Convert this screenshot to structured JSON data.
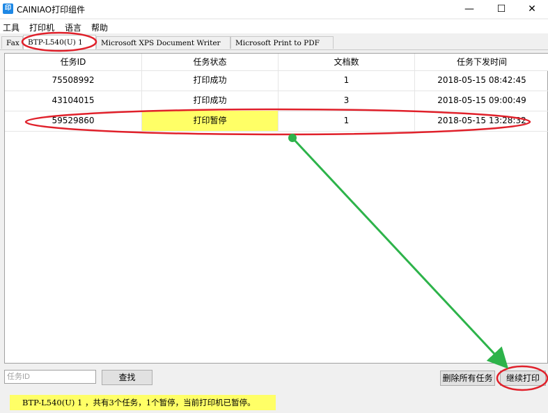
{
  "window": {
    "title": "CAINIAO打印组件",
    "icon_text": "印",
    "minimize_glyph": "—",
    "maximize_glyph": "☐",
    "close_glyph": "✕"
  },
  "menu": [
    "工具",
    "打印机",
    "语言",
    "帮助"
  ],
  "tabs": [
    {
      "label": "Fax",
      "active": false
    },
    {
      "label": "BTP-L540(U) 1",
      "active": true
    },
    {
      "label": "Microsoft XPS Document Writer",
      "active": false
    },
    {
      "label": "Microsoft Print to PDF",
      "active": false
    }
  ],
  "table": {
    "columns": [
      "任务ID",
      "任务状态",
      "文档数",
      "任务下发时间"
    ],
    "rows": [
      {
        "id": "75508992",
        "status": "打印成功",
        "docs": "1",
        "time": "2018-05-15 08:42:45"
      },
      {
        "id": "43104015",
        "status": "打印成功",
        "docs": "3",
        "time": "2018-05-15 09:00:49"
      },
      {
        "id": "59529860",
        "status": "打印暂停",
        "docs": "1",
        "time": "2018-05-15 13:28:32"
      }
    ]
  },
  "search": {
    "placeholder": "任务ID",
    "button": "查找"
  },
  "actions": {
    "delete_all": "删除所有任务",
    "resume": "继续打印"
  },
  "status": "BTP-L540(U) 1 ，共有3个任务，1个暂停，当前打印机已暂停。",
  "colors": {
    "highlight": "#ffff66",
    "annotation_red": "#e0202a",
    "annotation_green": "#2db34a"
  }
}
